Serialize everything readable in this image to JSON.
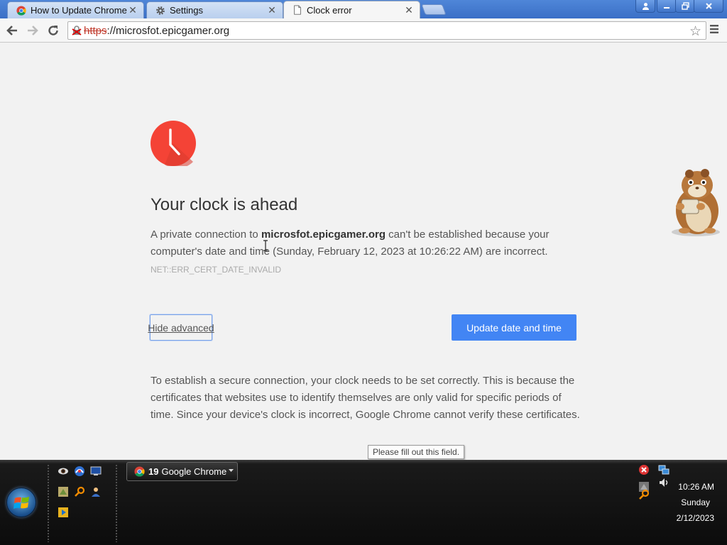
{
  "tabs": [
    {
      "title": "How to Update Chrome t",
      "favicon": "chrome-icon",
      "active": false
    },
    {
      "title": "Settings",
      "favicon": "gear-icon",
      "active": false
    },
    {
      "title": "Clock error",
      "favicon": "page-icon",
      "active": true
    }
  ],
  "tab_close_glyph": "✕",
  "toolbar": {
    "url_scheme": "https",
    "url_rest": "://microsfot.epicgamer.org",
    "star_glyph": "☆"
  },
  "error_page": {
    "heading": "Your clock is ahead",
    "msg_prefix": "A private connection to ",
    "msg_host": "microsfot.epicgamer.org",
    "msg_suffix": " can't be established because your computer's date and time (Sunday, February 12, 2023 at 10:26:22 AM) are incorrect.",
    "error_code": "NET::ERR_CERT_DATE_INVALID",
    "hide_advanced_label": "Hide advanced",
    "update_button_label": "Update date and time",
    "details": "To establish a secure connection, your clock needs to be set correctly. This is because the certificates that websites use to identify themselves are only valid for specific periods of time. Since your device's clock is incorrect, Google Chrome cannot verify these certificates.",
    "tooltip": "Please fill out this field."
  },
  "taskbar": {
    "chrome_count": "19",
    "chrome_label": "Google Chrome",
    "time": "10:26 AM",
    "day": "Sunday",
    "date": "2/12/2023"
  },
  "colors": {
    "accent_blue": "#4285f4",
    "clock_red": "#f44336",
    "titlebar_blue": "#3a6fc6"
  }
}
